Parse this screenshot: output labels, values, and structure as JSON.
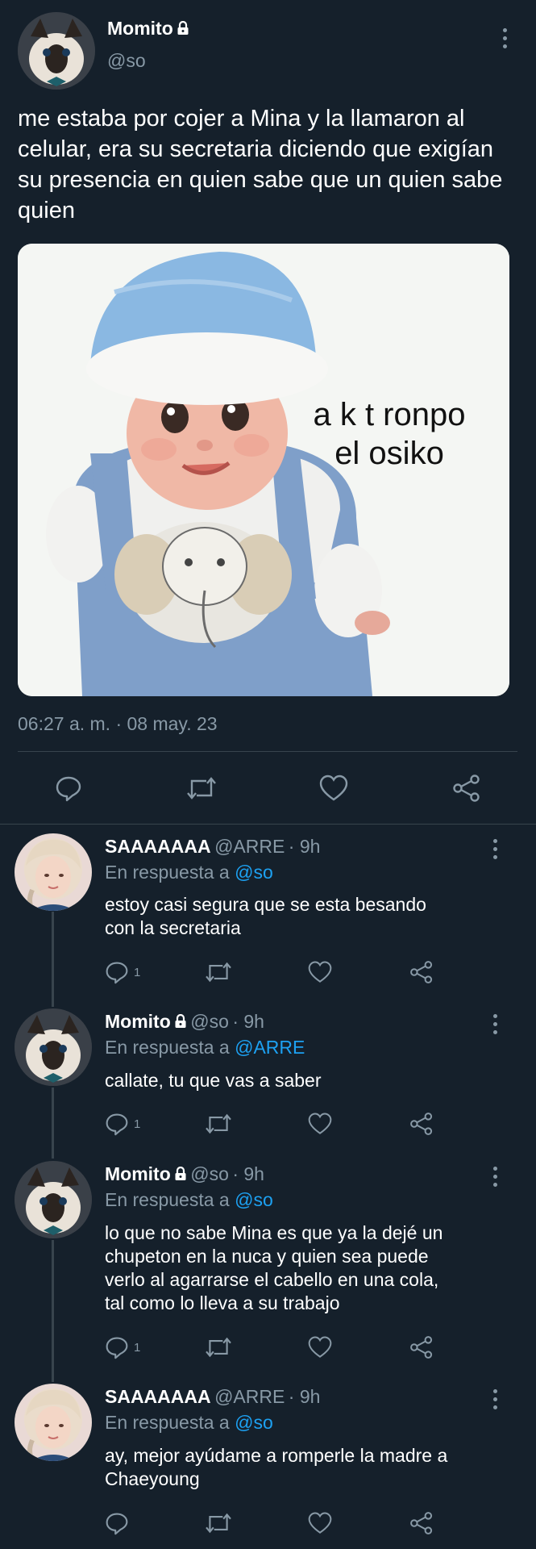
{
  "main_tweet": {
    "display_name": "Momito",
    "handle": "@so",
    "text": "me estaba por cojer a Mina y la llamaron al celular, era su secretaria diciendo que exigían su presencia en quien sabe que un quien sabe quien",
    "media_caption_line1": "a k t ronpo",
    "media_caption_line2": "el osiko",
    "timestamp": "06:27 a. m. · 08 may. 23"
  },
  "replies": [
    {
      "display_name": "SAAAAAAA",
      "handle": "@ARRE",
      "time": "· 9h",
      "reply_prefix": "En respuesta a",
      "reply_to": "@so",
      "text_lines": [
        "estoy casi segura que se esta besando",
        "con la secretaria"
      ],
      "reply_count": "1",
      "locked": false
    },
    {
      "display_name": "Momito",
      "handle": "@so",
      "time": "· 9h",
      "reply_prefix": "En respuesta a",
      "reply_to": "@ARRE",
      "text_lines": [
        "callate, tu que vas a saber"
      ],
      "reply_count": "1",
      "locked": true
    },
    {
      "display_name": "Momito",
      "handle": "@so",
      "time": "· 9h",
      "reply_prefix": "En respuesta a",
      "reply_to": "@so",
      "text_lines": [
        "lo que no sabe Mina es que ya la dejé un",
        "chupeton en la nuca y quien sea puede",
        "verlo al agarrarse el cabello en una cola,",
        "tal como lo lleva a su trabajo"
      ],
      "reply_count": "1",
      "locked": true
    },
    {
      "display_name": "SAAAAAAA",
      "handle": "@ARRE",
      "time": "· 9h",
      "reply_prefix": "En respuesta a",
      "reply_to": "@so",
      "text_lines": [
        "ay, mejor ayúdame a romperle la madre a",
        "Chaeyoung"
      ],
      "reply_count": "",
      "locked": false
    }
  ],
  "colors": {
    "background": "#15202b",
    "muted": "#8899a6",
    "link": "#1da1f2",
    "divider": "#38444d"
  },
  "icons": [
    "lock-icon",
    "more-icon",
    "reply-icon",
    "retweet-icon",
    "like-icon",
    "share-icon"
  ]
}
